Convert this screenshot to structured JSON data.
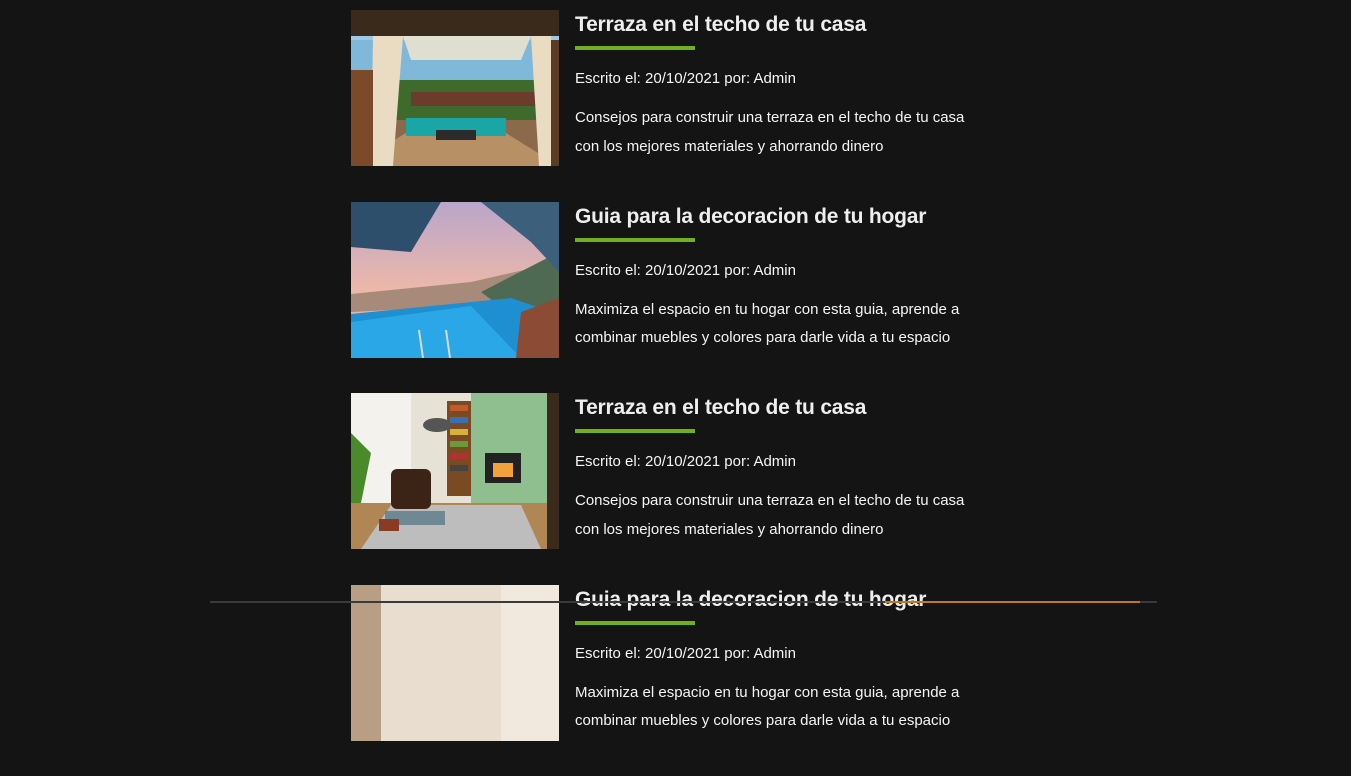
{
  "posts": [
    {
      "title": "Terraza en el techo de tu casa",
      "meta": "Escrito el: 20/10/2021 por: Admin",
      "excerpt": "Consejos para construir una terraza en el techo de tu casa con los mejores materiales y ahorrando dinero",
      "image": "terrace-photo"
    },
    {
      "title": "Guia para la decoracion de tu hogar",
      "meta": "Escrito el: 20/10/2021 por: Admin",
      "excerpt": "Maximiza el espacio en tu hogar con esta guia, aprende a combinar muebles y colores para darle vida a tu espacio",
      "image": "infinity-pool-photo"
    },
    {
      "title": "Terraza en el techo de tu casa",
      "meta": "Escrito el: 20/10/2021 por: Admin",
      "excerpt": "Consejos para construir una terraza en el techo de tu casa con los mejores materiales y ahorrando dinero",
      "image": "living-room-photo"
    },
    {
      "title": "Guia para la decoracion de tu hogar",
      "meta": "Escrito el: 20/10/2021 por: Admin",
      "excerpt": "Maximiza el espacio en tu hogar con esta guia, aprende a combinar muebles y colores para darle vida a tu espacio",
      "image": "interior-photo"
    }
  ],
  "colors": {
    "background": "#141414",
    "accent": "#6fb21a",
    "text": "#f5f5f5"
  }
}
